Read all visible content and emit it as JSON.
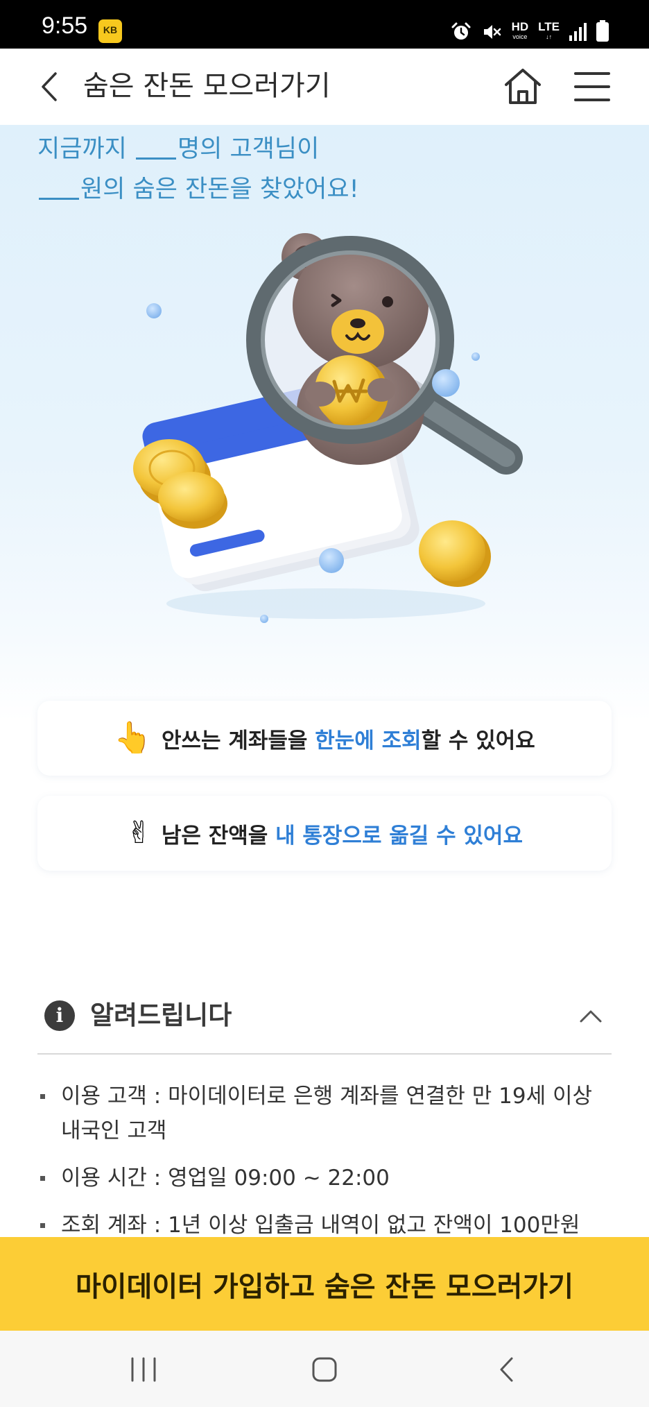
{
  "status_bar": {
    "time": "9:55",
    "badge": "KB",
    "network_label": "HD",
    "network_sub": "voice",
    "lte_label": "LTE",
    "icons": [
      "alarm-icon",
      "mute-icon",
      "hd-voice-icon",
      "lte-icon",
      "signal-icon",
      "battery-icon"
    ]
  },
  "header": {
    "title": "숨은 잔돈 모으러가기",
    "back_icon": "chevron-left-icon",
    "home_icon": "home-icon",
    "menu_icon": "hamburger-menu-icon"
  },
  "hero": {
    "stat_line1_prefix": "지금까지 ",
    "stat_line1_suffix": "명의 고객님이",
    "stat_line2_suffix": "원의 숨은 잔돈을 찾았어요!",
    "illustration": "bear-magnifier-coins-illustration"
  },
  "features": [
    {
      "icon": "pointing-hand-emoji",
      "hand": "👆",
      "text_before": "안쓰는 계좌들을 ",
      "highlight": "한눈에 조회",
      "text_after": "할 수 있어요"
    },
    {
      "icon": "victory-hand-emoji",
      "hand": "✌",
      "text_before": "남은 잔액을 ",
      "highlight": "내 통장으로 옮길 수 있어요",
      "text_after": ""
    }
  ],
  "notice": {
    "title": "알려드립니다",
    "info_glyph": "i",
    "items": [
      "이용 고객 : 마이데이터로 은행 계좌를 연결한 만 19세 이상 내국인 고객",
      "이용 시간 : 영업일 09:00 ~ 22:00",
      "조회 계좌 : 1년 이상 입출금 내역이 없고 잔액이 100만원"
    ]
  },
  "cta": {
    "label": "마이데이터 가입하고 숨은 잔돈 모으러가기"
  },
  "colors": {
    "accent_blue": "#2f7fd6",
    "stat_blue": "#3b8fc4",
    "cta_yellow": "#fccd36"
  }
}
